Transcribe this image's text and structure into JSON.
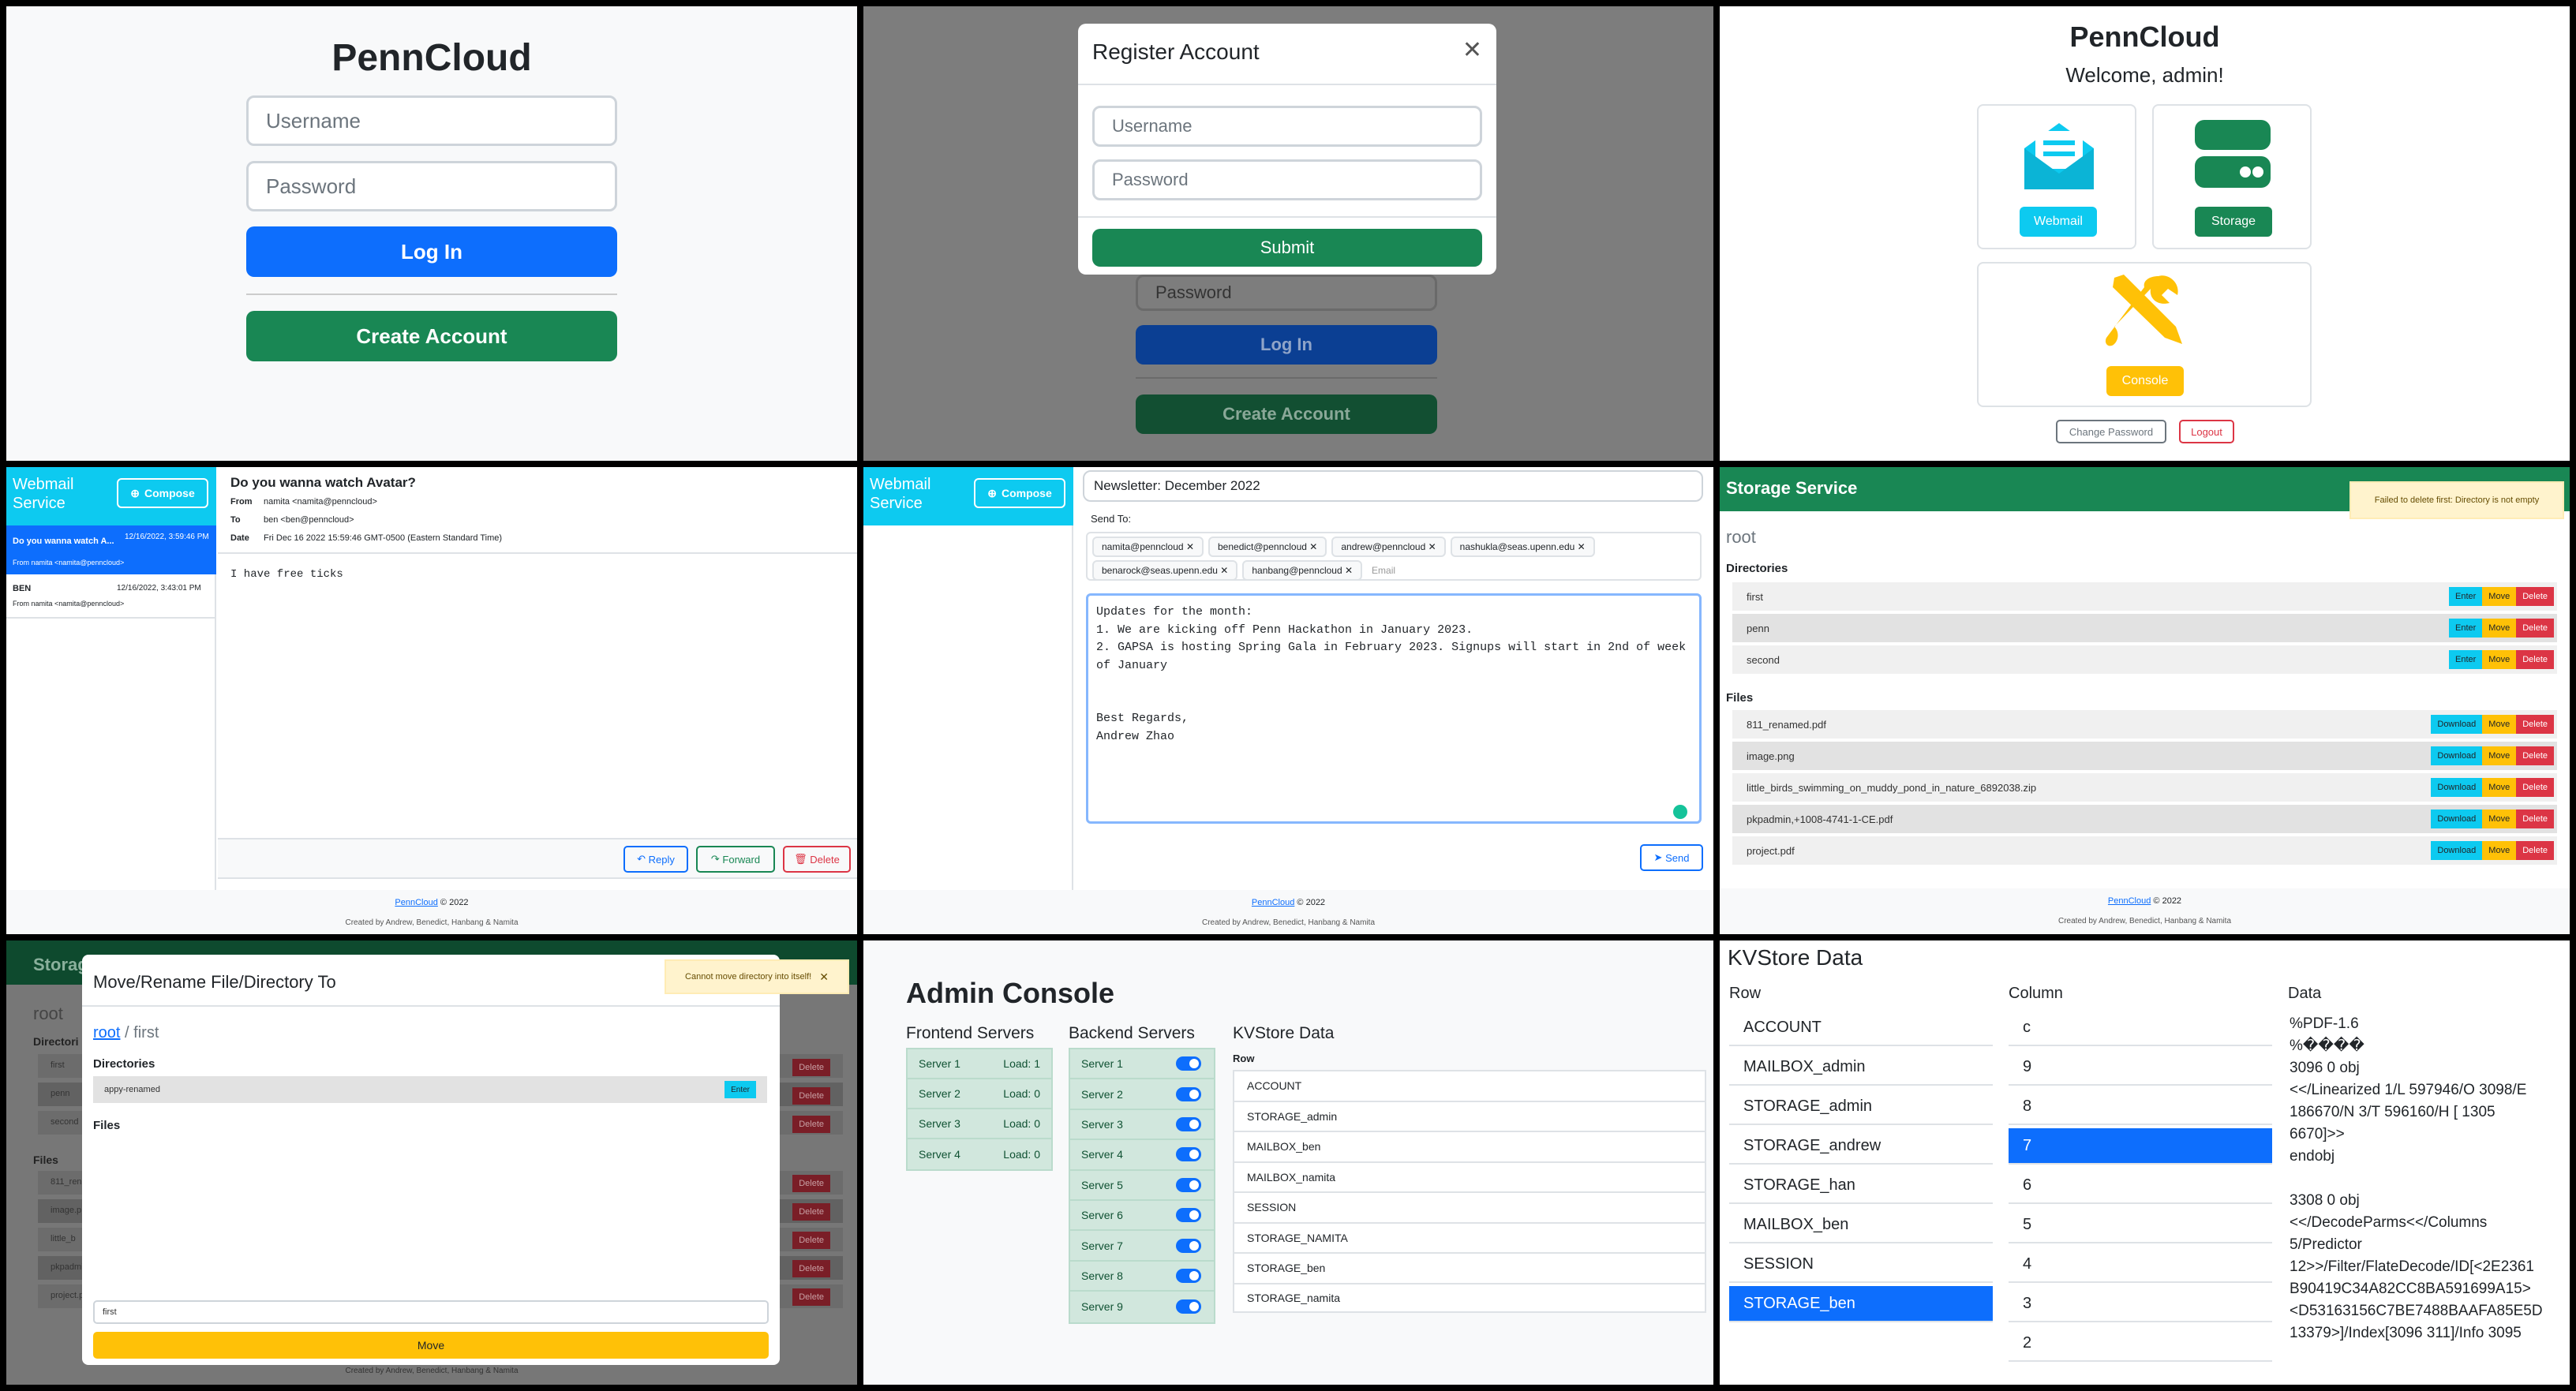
{
  "brand": "PennCloud",
  "login": {
    "username_placeholder": "Username",
    "password_placeholder": "Password",
    "login_label": "Log In",
    "create_label": "Create Account"
  },
  "register": {
    "title": "Register Account",
    "username_placeholder": "Username",
    "password_placeholder": "Password",
    "submit_label": "Submit",
    "bg_password": "Password",
    "bg_login": "Log In",
    "bg_create": "Create Account"
  },
  "home": {
    "welcome": "Welcome, admin!",
    "webmail": "Webmail",
    "storage": "Storage",
    "console": "Console",
    "change_password": "Change Password",
    "logout": "Logout"
  },
  "mail": {
    "service_title": "Webmail Service",
    "compose": "Compose",
    "list": [
      {
        "subject": "Do you wanna watch A...",
        "date": "12/16/2022, 3:59:46 PM",
        "from": "From namita <namita@penncloud>"
      },
      {
        "subject": "BEN",
        "date": "12/16/2022, 3:43:01 PM",
        "from": "From namita <namita@penncloud>"
      }
    ],
    "subject": "Do you wanna watch Avatar?",
    "from_label": "From",
    "from": "namita <namita@penncloud>",
    "to_label": "To",
    "to": "ben <ben@penncloud>",
    "date_label": "Date",
    "date": "Fri Dec 16 2022 15:59:46 GMT-0500 (Eastern Standard Time)",
    "body": "I have free ticks",
    "reply": "Reply",
    "forward": "Forward",
    "delete": "Delete",
    "footer_brand": "PennCloud",
    "footer_copy": "© 2022",
    "footer_credit": "Created by Andrew, Benedict, Hanbang & Namita"
  },
  "compose": {
    "subject": "Newsletter: December 2022",
    "send_to": "Send To:",
    "recipients": [
      "namita@penncloud",
      "benedict@penncloud",
      "andrew@penncloud",
      "nashukla@seas.upenn.edu",
      "benarock@seas.upenn.edu",
      "hanbang@penncloud"
    ],
    "email_placeholder": "Email",
    "body": "Updates for the month:\n1. We are kicking off Penn Hackathon in January 2023.\n2. GAPSA is hosting Spring Gala in February 2023. Signups will start in 2nd of week\nof January\n\n\nBest Regards,\nAndrew Zhao",
    "send": "Send"
  },
  "storage": {
    "title": "Storage Service",
    "toast": "Failed to delete first: Directory is not empty",
    "path": "root",
    "directories_label": "Directories",
    "directories": [
      "first",
      "penn",
      "second"
    ],
    "files_label": "Files",
    "files": [
      "811_renamed.pdf",
      "image.png",
      "little_birds_swimming_on_muddy_pond_in_nature_6892038.zip",
      "pkpadmin,+1008-4741-1-CE.pdf",
      "project.pdf"
    ],
    "enter": "Enter",
    "download": "Download",
    "move": "Move",
    "delete": "Delete"
  },
  "move_modal": {
    "bg_title": "Storag",
    "title": "Move/Rename File/Directory To",
    "toast": "Cannot move directory into itself!",
    "crumb_root": "root",
    "crumb_sep": "/",
    "crumb_current": "first",
    "directories_label": "Directories",
    "dir": "appy-renamed",
    "enter": "Enter",
    "files_label": "Files",
    "input_value": "first",
    "move": "Move",
    "bg_root": "root",
    "bg_directories": "Directori",
    "bg_dirs": [
      "first",
      "penn",
      "second"
    ],
    "bg_files": "Files",
    "bg_file_names": [
      "811_rena",
      "image.p",
      "little_b",
      "pkpadmi",
      "project.p"
    ],
    "bg_delete": "Delete",
    "bg_footer": "Created by Andrew, Benedict, Hanbang & Namita"
  },
  "admin": {
    "title": "Admin Console",
    "frontend_label": "Frontend Servers",
    "backend_label": "Backend Servers",
    "kv_label": "KVStore Data",
    "frontend": [
      {
        "name": "Server 1",
        "load": "Load: 1"
      },
      {
        "name": "Server 2",
        "load": "Load: 0"
      },
      {
        "name": "Server 3",
        "load": "Load: 0"
      },
      {
        "name": "Server 4",
        "load": "Load: 0"
      }
    ],
    "backend": [
      "Server 1",
      "Server 2",
      "Server 3",
      "Server 4",
      "Server 5",
      "Server 6",
      "Server 7",
      "Server 8",
      "Server 9"
    ],
    "row_label": "Row",
    "rows": [
      "ACCOUNT",
      "STORAGE_admin",
      "MAILBOX_ben",
      "MAILBOX_namita",
      "SESSION",
      "STORAGE_NAMITA",
      "STORAGE_ben",
      "STORAGE_namita"
    ]
  },
  "kv": {
    "title": "KVStore Data",
    "row_label": "Row",
    "col_label": "Column",
    "data_label": "Data",
    "rows": [
      "ACCOUNT",
      "MAILBOX_admin",
      "STORAGE_admin",
      "STORAGE_andrew",
      "STORAGE_han",
      "MAILBOX_ben",
      "SESSION",
      "STORAGE_ben"
    ],
    "columns": [
      "c",
      "9",
      "8",
      "7",
      "6",
      "5",
      "4",
      "3",
      "2"
    ],
    "data_lines": [
      "%PDF-1.6",
      "%����",
      "3096 0 obj",
      "<</Linearized 1/L 597946/O 3098/E",
      "186670/N 3/T 596160/H [ 1305",
      "6670]>>",
      "endobj",
      "",
      "3308 0 obj",
      "<</DecodeParms<</Columns",
      "5/Predictor",
      "12>>/Filter/FlateDecode/ID[<2E2361",
      "B90419C34A82CC8BA591699A15>",
      "<D53163156C7BE7488BAAFA85E5D",
      "13379>]/Index[3096 311]/Info 3095"
    ]
  }
}
